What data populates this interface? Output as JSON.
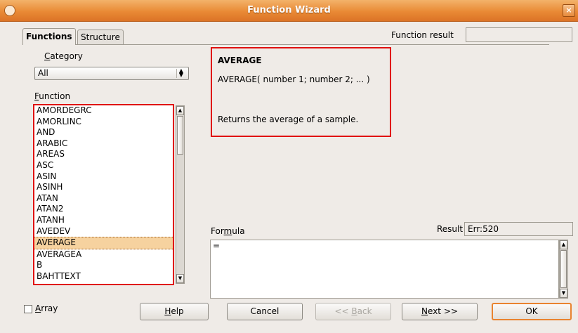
{
  "window": {
    "title": "Function Wizard",
    "close_glyph": "×"
  },
  "tabs": [
    {
      "label": "Functions"
    },
    {
      "label": "Structure"
    }
  ],
  "function_result": {
    "label": "Function result",
    "value": ""
  },
  "category": {
    "label": "Category",
    "label_mnemonic": "C",
    "label_rest": "ategory",
    "selected": "All"
  },
  "function_list": {
    "label_mnemonic": "F",
    "label_rest": "unction",
    "items": [
      "AMORDEGRC",
      "AMORLINC",
      "AND",
      "ARABIC",
      "AREAS",
      "ASC",
      "ASIN",
      "ASINH",
      "ATAN",
      "ATAN2",
      "ATANH",
      "AVEDEV",
      "AVERAGE",
      "AVERAGEA",
      "B",
      "BAHTTEXT"
    ],
    "selected": "AVERAGE"
  },
  "info": {
    "name": "AVERAGE",
    "syntax": "AVERAGE( number 1; number 2; ...  )",
    "description": "Returns the average of a sample."
  },
  "formula": {
    "label_a": "For",
    "label_m": "m",
    "label_b": "ula",
    "value": "="
  },
  "result": {
    "label": "Result",
    "value": "Err:520"
  },
  "array": {
    "label_mnemonic": "A",
    "label_rest": "rray",
    "checked": false
  },
  "buttons": {
    "help": {
      "mnemonic": "H",
      "rest": "elp"
    },
    "cancel": "Cancel",
    "back": {
      "prefix": "<< ",
      "mnemonic": "B",
      "rest": "ack"
    },
    "next": {
      "mnemonic": "N",
      "rest": "ext >>"
    },
    "ok": "OK"
  },
  "colors": {
    "title_bar": "#e98a35",
    "highlight_box": "#e01010",
    "selection": "#f6d29f",
    "default_button_border": "#e9832f"
  }
}
